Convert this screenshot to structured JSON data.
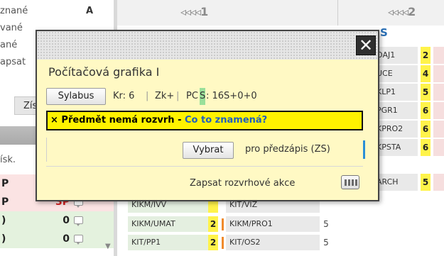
{
  "left_column": {
    "status_lines": [
      "znané",
      "vané",
      "ané",
      "apsat"
    ],
    "marker_letter": "A",
    "button_fragment": "Zís",
    "header_fragment": "ísk.",
    "rows": [
      {
        "letter": "P",
        "value": "",
        "value_color": "#222"
      },
      {
        "letter": "P",
        "value": "3P",
        "value_color": "#d42020"
      },
      {
        "letter": ")",
        "value": "0",
        "value_color": "#222"
      },
      {
        "letter": ")",
        "value": "0",
        "value_color": "#222"
      }
    ]
  },
  "header": {
    "block1_label": "◃◃◃◃1",
    "block2_label": "◃◃◃◃2",
    "column_fragment": "S"
  },
  "right_cells": [
    {
      "code": "OAJ1",
      "num": "2"
    },
    {
      "code": "UCE",
      "num": "4"
    },
    {
      "code": "KLP1",
      "num": "5"
    },
    {
      "code": "PGR1",
      "num": "6"
    },
    {
      "code": "KPRO2",
      "num": "6"
    },
    {
      "code": "KPSTA",
      "num": "6"
    },
    {
      "code": "ARCH",
      "num": "5"
    }
  ],
  "bottom_grid": [
    {
      "c1": "KIKM/IVV",
      "n1": "",
      "c2": "KIT/VIZ",
      "n2": ""
    },
    {
      "c1": "KIKM/UMAT",
      "n1": "2",
      "c2": "KIKM/PRO1",
      "n2": "5"
    },
    {
      "c1": "KIT/PP1",
      "n1": "2",
      "c2": "KIT/OS2",
      "n2": "5"
    }
  ],
  "popup": {
    "title": "Počítačová grafika I",
    "close_glyph": "✕",
    "sylabus_label": "Sylabus",
    "credits": "Kr: 6",
    "completion": "Zk+",
    "pcs_prefix": "PC",
    "pcs_highlight": "S",
    "pcs_value": ": 16S+0+0",
    "separator": "|",
    "warning_prefix": "× Předmět nemá rozvrh",
    "warning_dash": " - ",
    "warning_link": "Co to znamená?",
    "vybrat_label": "Vybrat",
    "prezapis_text": "pro předzápis (ZS)",
    "akce_text": "Zapsat rozvrhové akce"
  },
  "icons": {
    "comment": "comment-icon",
    "calendar": "calendar-icon",
    "close": "close-icon"
  },
  "colors": {
    "popup_bg": "#fff9c4",
    "warning_bg": "#fff200",
    "link": "#1f5fbf",
    "pcs_highlight": "#9ae09a",
    "cell_yellow": "#fff34a",
    "accent_blue": "#2a8fd6",
    "accent_orange": "#f08a2c",
    "red_value": "#d42020"
  }
}
